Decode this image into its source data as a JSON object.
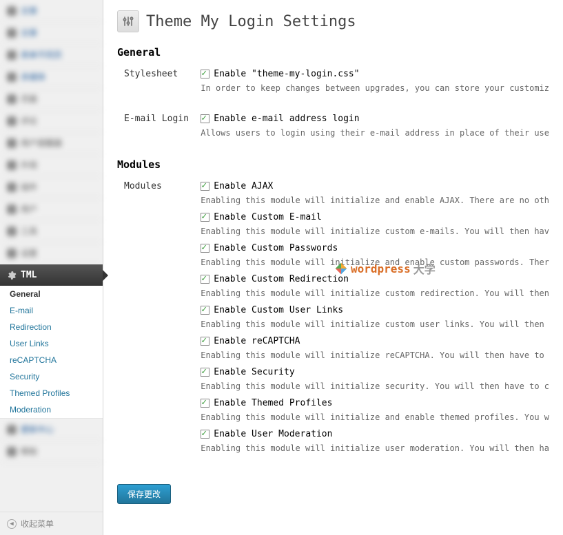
{
  "sidebar": {
    "active_label": "TML",
    "submenu": [
      {
        "label": "General",
        "bold": true
      },
      {
        "label": "E-mail",
        "bold": false
      },
      {
        "label": "Redirection",
        "bold": false
      },
      {
        "label": "User Links",
        "bold": false
      },
      {
        "label": "reCAPTCHA",
        "bold": false
      },
      {
        "label": "Security",
        "bold": false
      },
      {
        "label": "Themed Profiles",
        "bold": false
      },
      {
        "label": "Moderation",
        "bold": false
      }
    ],
    "collapse_label": "收起菜单"
  },
  "page_title": "Theme My Login Settings",
  "sections": {
    "general": {
      "heading": "General",
      "stylesheet": {
        "label": "Stylesheet",
        "checkbox_label": "Enable \"theme-my-login.css\"",
        "desc": "In order to keep changes between upgrades, you can store your customiz"
      },
      "email_login": {
        "label": "E-mail Login",
        "checkbox_label": "Enable e-mail address login",
        "desc": "Allows users to login using their e-mail address in place of their use"
      }
    },
    "modules": {
      "heading": "Modules",
      "label": "Modules",
      "items": [
        {
          "label": "Enable AJAX",
          "desc": "Enabling this module will initialize and enable AJAX. There are no oth"
        },
        {
          "label": "Enable Custom E-mail",
          "desc": "Enabling this module will initialize custom e-mails. You will then hav"
        },
        {
          "label": "Enable Custom Passwords",
          "desc": "Enabling this module will initialize and enable custom passwords. Ther"
        },
        {
          "label": "Enable Custom Redirection",
          "desc": "Enabling this module will initialize custom redirection. You will then"
        },
        {
          "label": "Enable Custom User Links",
          "desc": "Enabling this module will initialize custom user links. You will then "
        },
        {
          "label": "Enable reCAPTCHA",
          "desc": "Enabling this module will initialize reCAPTCHA. You will then have to "
        },
        {
          "label": "Enable Security",
          "desc": "Enabling this module will initialize security. You will then have to c"
        },
        {
          "label": "Enable Themed Profiles",
          "desc": "Enabling this module will initialize and enable themed profiles. You w"
        },
        {
          "label": "Enable User Moderation",
          "desc": "Enabling this module will initialize user moderation. You will then ha"
        }
      ]
    }
  },
  "save_button": "保存更改",
  "watermark": {
    "text": "wordpress",
    "suffix": "大学"
  }
}
